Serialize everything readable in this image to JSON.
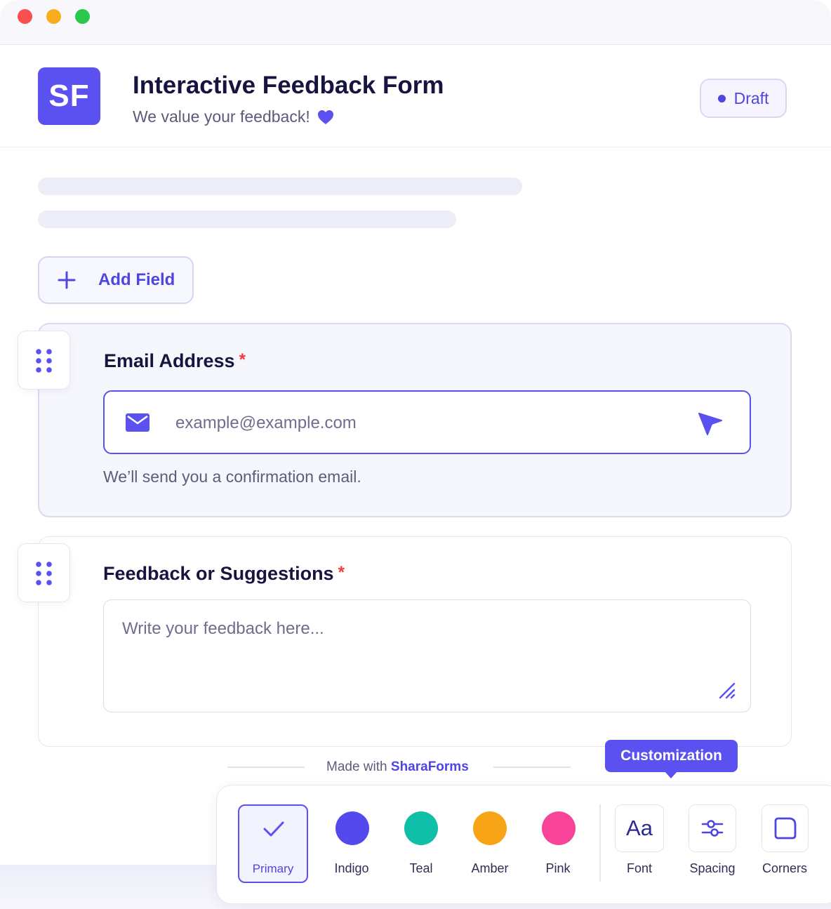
{
  "header": {
    "logo_text": "SF",
    "title": "Interactive Feedback Form",
    "subtitle": "We value your feedback!",
    "status_badge": "Draft"
  },
  "actions": {
    "add_field_label": "Add Field"
  },
  "fields": [
    {
      "label": "Email Address",
      "required_mark": "*",
      "placeholder": "example@example.com",
      "helper": "We’ll send you a confirmation email."
    },
    {
      "label": "Feedback or Suggestions",
      "required_mark": "*",
      "placeholder": "Write your feedback here..."
    }
  ],
  "footer": {
    "made_with": "Made with",
    "brand": "SharaForms"
  },
  "customization": {
    "tooltip": "Customization",
    "colors": [
      {
        "label": "Primary",
        "hex": "#5b50f0",
        "selected": true
      },
      {
        "label": "Indigo",
        "hex": "#5449ec"
      },
      {
        "label": "Teal",
        "hex": "#10bfa8"
      },
      {
        "label": "Amber",
        "hex": "#f7a417"
      },
      {
        "label": "Pink",
        "hex": "#f74398"
      }
    ],
    "tools": [
      {
        "label": "Font",
        "icon_text": "Aa"
      },
      {
        "label": "Spacing",
        "icon": "sliders-icon"
      },
      {
        "label": "Corners",
        "icon": "corner-radius-icon"
      }
    ]
  },
  "theme": {
    "accent": "#5b50f0",
    "required": "#ef3b3b"
  }
}
